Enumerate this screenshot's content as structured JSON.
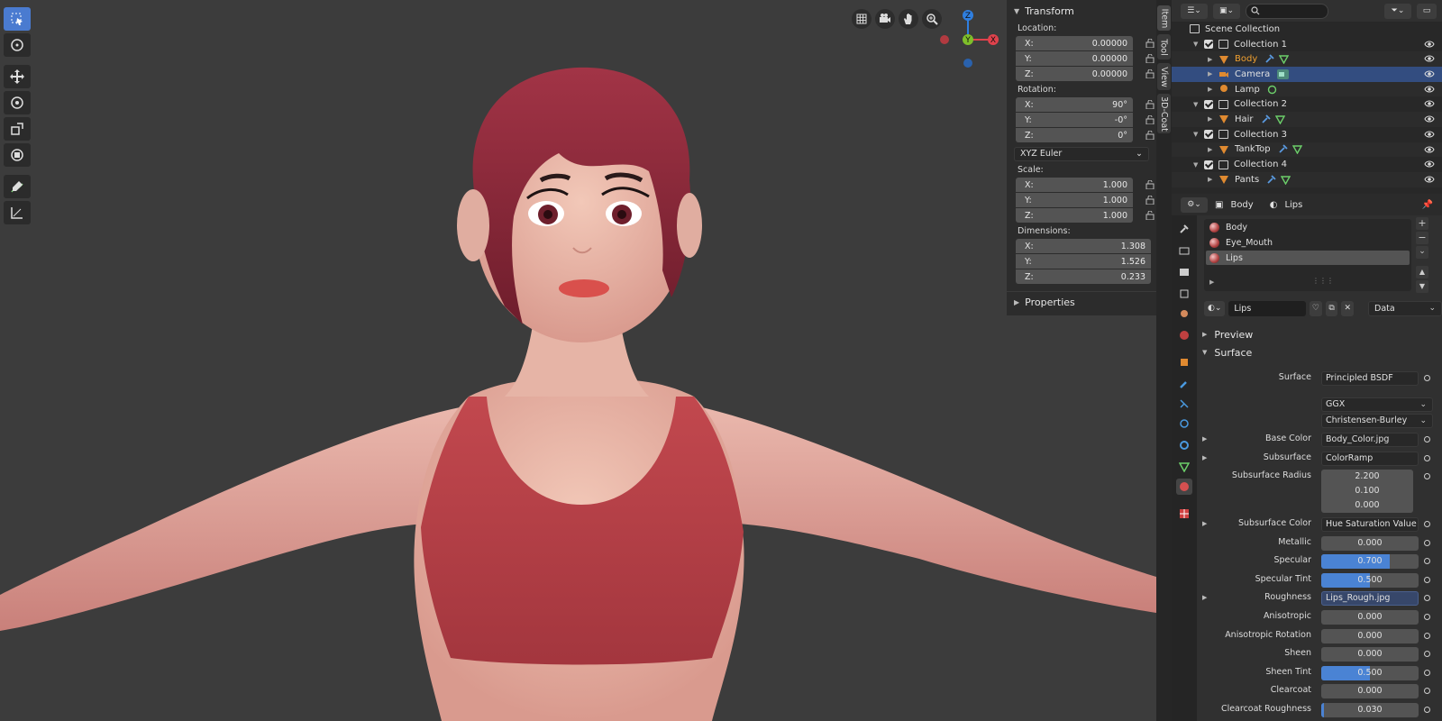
{
  "viewport": {
    "background": "#3c3c3c",
    "tools": [
      "select-box-icon",
      "cursor-icon",
      "move-icon",
      "rotate-icon",
      "scale-icon",
      "transform-icon",
      "annotate-icon",
      "measure-icon"
    ],
    "view_icons": [
      "grid-icon",
      "camera-icon",
      "hand-icon",
      "zoom-icon"
    ],
    "gizmo": {
      "z": "Z",
      "y": "Y",
      "x": "X",
      "colors": {
        "x": "#e0424c",
        "y": "#7fbf2a",
        "z": "#2f7fe0"
      }
    }
  },
  "npanel": {
    "transform_title": "Transform",
    "location_label": "Location:",
    "location": {
      "x_label": "X:",
      "x": "0.00000",
      "y_label": "Y:",
      "y": "0.00000",
      "z_label": "Z:",
      "z": "0.00000"
    },
    "rotation_label": "Rotation:",
    "rotation": {
      "x_label": "X:",
      "x": "90°",
      "y_label": "Y:",
      "y": "-0°",
      "z_label": "Z:",
      "z": "0°"
    },
    "rotation_mode": "XYZ Euler",
    "scale_label": "Scale:",
    "scale": {
      "x_label": "X:",
      "x": "1.000",
      "y_label": "Y:",
      "y": "1.000",
      "z_label": "Z:",
      "z": "1.000"
    },
    "dimensions_label": "Dimensions:",
    "dimensions": {
      "x_label": "X:",
      "x": "1.308",
      "y_label": "Y:",
      "y": "1.526",
      "z_label": "Z:",
      "z": "0.233"
    },
    "properties_title": "Properties"
  },
  "side_tabs": [
    "Item",
    "Tool",
    "View",
    "3D-Coat"
  ],
  "outliner": {
    "scene_collection": "Scene Collection",
    "rows": [
      {
        "name": "Collection 1",
        "type": "collection"
      },
      {
        "name": "Body",
        "type": "mesh",
        "highlight": true
      },
      {
        "name": "Camera",
        "type": "camera",
        "selected": true
      },
      {
        "name": "Lamp",
        "type": "light"
      },
      {
        "name": "Collection 2",
        "type": "collection"
      },
      {
        "name": "Hair",
        "type": "mesh"
      },
      {
        "name": "Collection 3",
        "type": "collection"
      },
      {
        "name": "TankTop",
        "type": "mesh"
      },
      {
        "name": "Collection 4",
        "type": "collection"
      },
      {
        "name": "Pants",
        "type": "mesh"
      }
    ]
  },
  "properties": {
    "breadcrumb_object": "Body",
    "breadcrumb_material": "Lips",
    "material_slots": [
      "Body",
      "Eye_Mouth",
      "Lips"
    ],
    "material_name": "Lips",
    "link_mode": "Data",
    "preview_title": "Preview",
    "surface_title": "Surface",
    "fields": [
      {
        "label": "Surface",
        "value": "Principled BSDF",
        "kind": "link"
      },
      {
        "label": "",
        "value": "GGX",
        "kind": "dropdown"
      },
      {
        "label": "",
        "value": "Christensen-Burley",
        "kind": "dropdown"
      },
      {
        "label": "Base Color",
        "value": "Body_Color.jpg",
        "kind": "link",
        "expand": true
      },
      {
        "label": "Subsurface",
        "value": "ColorRamp",
        "kind": "link",
        "expand": true
      },
      {
        "label": "Subsurface Radius",
        "value": "2.200",
        "kind": "vec"
      },
      {
        "label": "",
        "value": "0.100",
        "kind": "vec"
      },
      {
        "label": "",
        "value": "0.000",
        "kind": "vec"
      },
      {
        "label": "Subsurface Color",
        "value": "Hue Saturation Value",
        "kind": "link",
        "expand": true
      },
      {
        "label": "Metallic",
        "value": "0.000",
        "kind": "num",
        "fill": 0
      },
      {
        "label": "Specular",
        "value": "0.700",
        "kind": "num",
        "fill": 0.7
      },
      {
        "label": "Specular Tint",
        "value": "0.500",
        "kind": "num",
        "fill": 0.5
      },
      {
        "label": "Roughness",
        "value": "Lips_Rough.jpg",
        "kind": "link",
        "expand": true,
        "active": true
      },
      {
        "label": "Anisotropic",
        "value": "0.000",
        "kind": "num",
        "fill": 0
      },
      {
        "label": "Anisotropic Rotation",
        "value": "0.000",
        "kind": "num",
        "fill": 0
      },
      {
        "label": "Sheen",
        "value": "0.000",
        "kind": "num",
        "fill": 0
      },
      {
        "label": "Sheen Tint",
        "value": "0.500",
        "kind": "num",
        "fill": 0.5
      },
      {
        "label": "Clearcoat",
        "value": "0.000",
        "kind": "num",
        "fill": 0
      },
      {
        "label": "Clearcoat Roughness",
        "value": "0.030",
        "kind": "num",
        "fill": 0.03
      }
    ]
  }
}
